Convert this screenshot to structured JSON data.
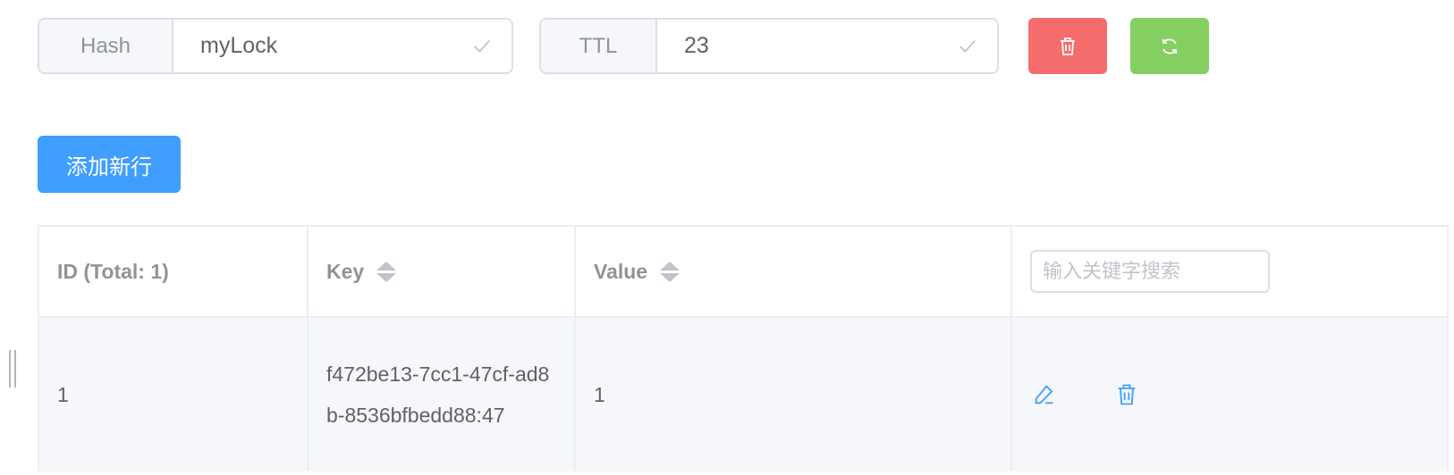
{
  "toolbar": {
    "hash_label": "Hash",
    "hash_value": "myLock",
    "ttl_label": "TTL",
    "ttl_value": "23",
    "delete_icon": "trash-icon",
    "refresh_icon": "refresh-icon",
    "add_row_label": "添加新行"
  },
  "table": {
    "columns": [
      "ID (Total: 1)",
      "Key",
      "Value"
    ],
    "search_placeholder": "输入关键字搜索",
    "rows": [
      {
        "id": "1",
        "key": "f472be13-7cc1-47cf-ad8b-8536bfbedd88:47",
        "value": "1"
      }
    ]
  },
  "colors": {
    "danger": "#f56c6c",
    "success": "#85ce61",
    "primary": "#409eff"
  }
}
